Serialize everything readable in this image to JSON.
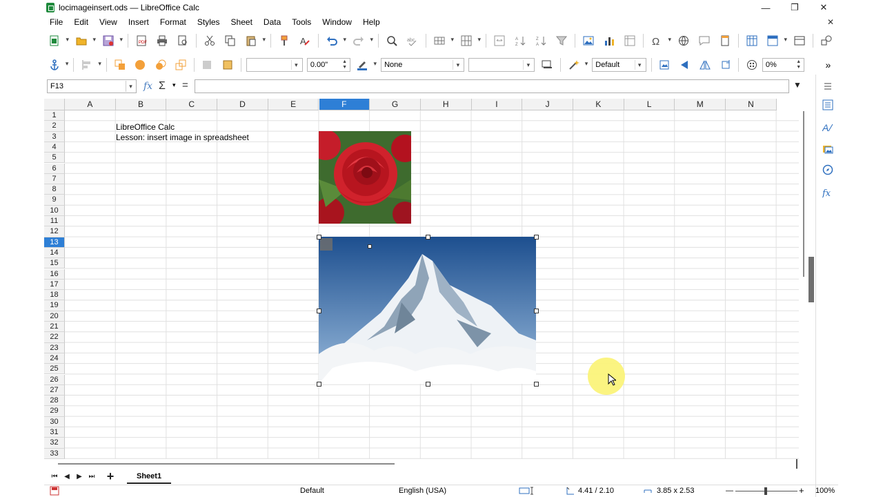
{
  "window": {
    "title": "locimageinsert.ods — LibreOffice Calc",
    "controls": {
      "minimize": "—",
      "restore": "❐",
      "close": "✕"
    }
  },
  "menu": {
    "items": [
      "File",
      "Edit",
      "View",
      "Insert",
      "Format",
      "Styles",
      "Sheet",
      "Data",
      "Tools",
      "Window",
      "Help"
    ],
    "close_doc": "✕"
  },
  "drawbar": {
    "line_width": "0.00\"",
    "area_style": "None",
    "area_fill": "",
    "image_mode": "Default",
    "transparency": "0%"
  },
  "formula": {
    "name_box": "F13",
    "fx": "fx",
    "sigma": "Σ",
    "equals": "=",
    "content": ""
  },
  "grid": {
    "columns": [
      "A",
      "B",
      "C",
      "D",
      "E",
      "F",
      "G",
      "H",
      "I",
      "J",
      "K",
      "L",
      "M",
      "N"
    ],
    "selected_column": "F",
    "rows": [
      "1",
      "2",
      "3",
      "4",
      "5",
      "6",
      "7",
      "8",
      "9",
      "10",
      "11",
      "12",
      "13",
      "14",
      "15",
      "16",
      "17",
      "18",
      "19",
      "20",
      "21",
      "22",
      "23",
      "24",
      "25",
      "26",
      "27",
      "28",
      "29",
      "30",
      "31",
      "32",
      "33"
    ],
    "selected_row": "13",
    "cells": {
      "B2": "LibreOffice Calc",
      "B3": "Lesson: insert image in spreadsheet"
    }
  },
  "images": [
    {
      "name": "rose",
      "anchor": "F3"
    },
    {
      "name": "mountain",
      "anchor": "F13",
      "selected": true
    }
  ],
  "sheets": {
    "tabs": [
      "Sheet1"
    ],
    "active": "Sheet1",
    "add": "+"
  },
  "status": {
    "page_style": "Default",
    "language": "English (USA)",
    "position": "4.41 / 2.10",
    "size": "3.85 x 2.53",
    "zoom_minus": "—",
    "zoom_plus": "+",
    "zoom": "100%"
  },
  "colors": {
    "selection": "#2e7fd6",
    "header_bg": "#f2f2f2",
    "cursor_highlight": "#fbf37a"
  }
}
